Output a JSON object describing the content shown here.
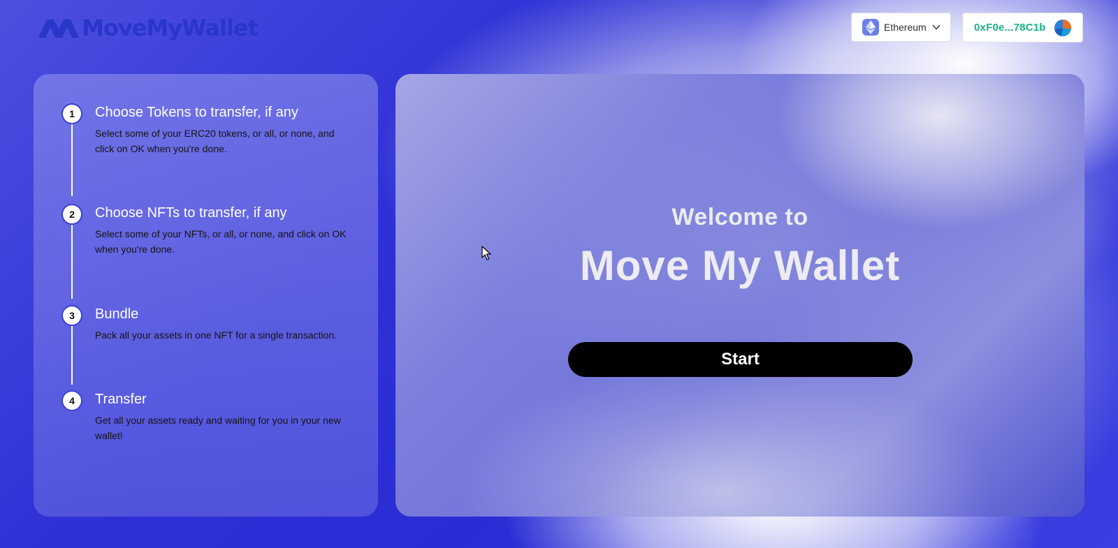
{
  "header": {
    "logo_text": "MoveMyWallet",
    "network": {
      "label": "Ethereum",
      "icon": "ethereum-icon"
    },
    "wallet": {
      "address": "0xF0e...78C1b",
      "icon": "wallet-avatar"
    }
  },
  "steps": [
    {
      "number": "1",
      "title": "Choose Tokens to transfer, if any",
      "description": "Select some of your ERC20 tokens, or all, or none, and click on OK when you're done."
    },
    {
      "number": "2",
      "title": "Choose NFTs to transfer, if any",
      "description": "Select some of your NFTs, or all, or none, and click on OK when you're done."
    },
    {
      "number": "3",
      "title": "Bundle",
      "description": "Pack all your assets in one NFT for a single transaction."
    },
    {
      "number": "4",
      "title": "Transfer",
      "description": "Get all your assets ready and waiting for you in your new wallet!"
    }
  ],
  "welcome": {
    "subtitle": "Welcome to",
    "title": "Move My Wallet",
    "start_label": "Start"
  },
  "colors": {
    "brand": "#2a36c9",
    "address_green": "#17b38a",
    "button_black": "#000000",
    "background_blue": "#2f31d6"
  }
}
